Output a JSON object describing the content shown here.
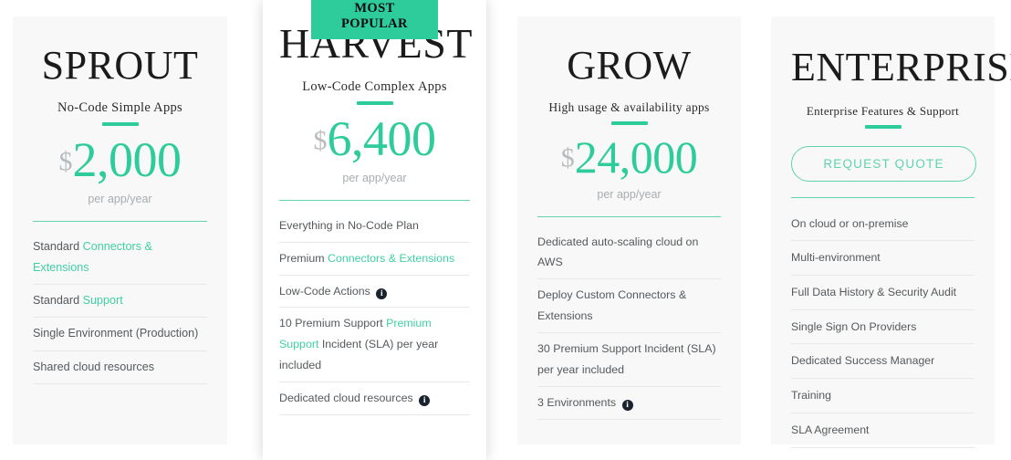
{
  "badge": {
    "line1": "MOST",
    "line2": "POPULAR"
  },
  "plans": [
    {
      "id": "sprout",
      "name": "SPROUT",
      "tagline": "No-Code Simple Apps",
      "currency": "$",
      "amount": "2,000",
      "period": "per app/year",
      "features": [
        {
          "parts": [
            {
              "text": "Standard ",
              "style": "normal"
            },
            {
              "text": "Connectors & Extensions",
              "style": "highlight"
            }
          ]
        },
        {
          "parts": [
            {
              "text": "Standard ",
              "style": "normal"
            },
            {
              "text": "Support",
              "style": "highlight"
            }
          ]
        },
        {
          "parts": [
            {
              "text": "Single Environment (Production)",
              "style": "normal"
            }
          ]
        },
        {
          "parts": [
            {
              "text": "Shared cloud resources",
              "style": "normal"
            }
          ]
        }
      ]
    },
    {
      "id": "harvest",
      "name": "HARVEST",
      "tagline": "Low-Code Complex Apps",
      "currency": "$",
      "amount": "6,400",
      "period": "per app/year",
      "features": [
        {
          "parts": [
            {
              "text": "Everything in No-Code Plan",
              "style": "normal"
            }
          ]
        },
        {
          "parts": [
            {
              "text": "Premium ",
              "style": "normal"
            },
            {
              "text": "Connectors & Extensions",
              "style": "highlight"
            }
          ]
        },
        {
          "parts": [
            {
              "text": "Low-Code Actions ",
              "style": "normal"
            },
            {
              "text": "i",
              "style": "info-icon"
            }
          ]
        },
        {
          "parts": [
            {
              "text": "10 Premium Support ",
              "style": "normal"
            },
            {
              "text": "Premium Support",
              "style": "highlight"
            },
            {
              "text": " Incident (SLA) per year included",
              "style": "normal"
            }
          ]
        },
        {
          "parts": [
            {
              "text": "Dedicated cloud resources ",
              "style": "normal"
            },
            {
              "text": "i",
              "style": "info-icon"
            }
          ]
        }
      ]
    },
    {
      "id": "grow",
      "name": "GROW",
      "tagline": "High usage & availability apps",
      "currency": "$",
      "amount": "24,000",
      "period": "per app/year",
      "features": [
        {
          "parts": [
            {
              "text": "Dedicated auto-scaling cloud on AWS",
              "style": "normal"
            }
          ]
        },
        {
          "parts": [
            {
              "text": "Deploy Custom Connectors & Extensions",
              "style": "normal"
            }
          ]
        },
        {
          "parts": [
            {
              "text": "30 Premium Support Incident (SLA) per year included",
              "style": "normal"
            }
          ]
        },
        {
          "parts": [
            {
              "text": "3 Environments ",
              "style": "normal"
            },
            {
              "text": "i",
              "style": "info-icon"
            }
          ]
        }
      ]
    },
    {
      "id": "enterprise",
      "name": "ENTERPRISE",
      "tagline": "Enterprise Features & Support",
      "cta_label": "REQUEST QUOTE",
      "features": [
        {
          "parts": [
            {
              "text": "On cloud or on-premise",
              "style": "normal"
            }
          ]
        },
        {
          "parts": [
            {
              "text": "Multi-environment",
              "style": "normal"
            }
          ]
        },
        {
          "parts": [
            {
              "text": "Full Data History & Security Audit",
              "style": "normal"
            }
          ]
        },
        {
          "parts": [
            {
              "text": "Single Sign On Providers",
              "style": "normal"
            }
          ]
        },
        {
          "parts": [
            {
              "text": "Dedicated Success Manager",
              "style": "normal"
            }
          ]
        },
        {
          "parts": [
            {
              "text": "Training",
              "style": "normal"
            }
          ]
        },
        {
          "parts": [
            {
              "text": "SLA Agreement",
              "style": "normal"
            }
          ]
        }
      ]
    }
  ],
  "colors": {
    "accent_green": "#2ecc9a",
    "link_green": "#3fd0a2",
    "card_background": "#f8f8f8",
    "featured_background": "#ffffff",
    "body_text": "#55595c",
    "muted_text": "#a9adaf",
    "info_icon": "#19222e"
  }
}
